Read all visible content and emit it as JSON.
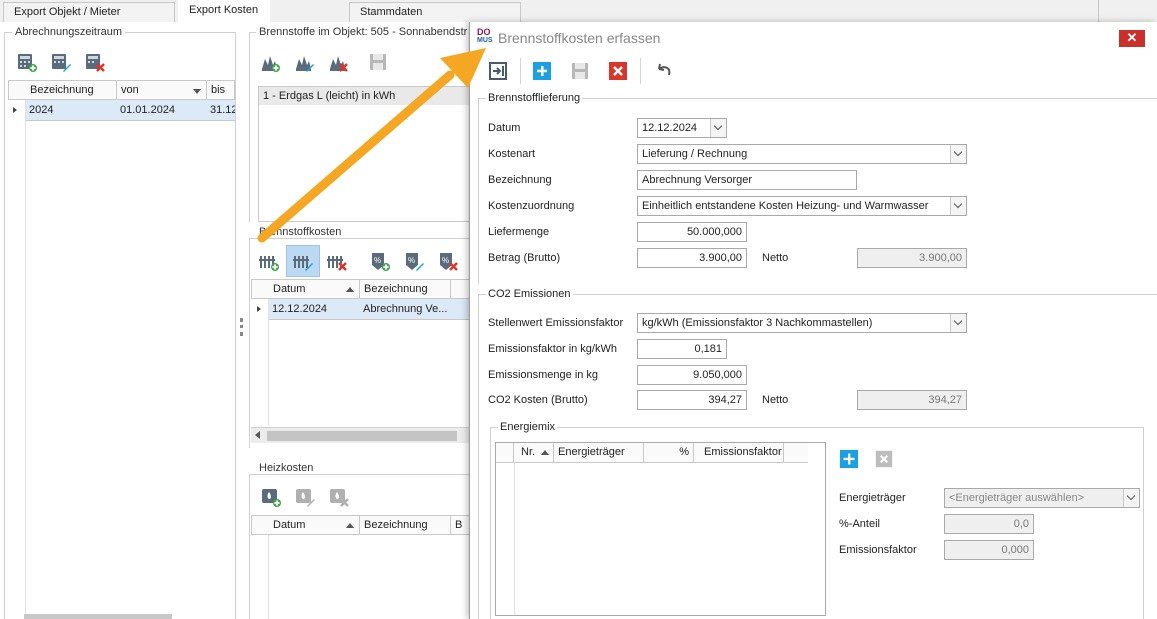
{
  "tabs": [
    "Export Objekt / Mieter",
    "Export Kosten",
    "Stammdaten"
  ],
  "left": {
    "title": "Abrechnungszeitraum",
    "columns": [
      "Bezeichnung",
      "von",
      "bis"
    ],
    "row": {
      "bezeichnung": "2024",
      "von": "01.01.2024",
      "bis": "31.12"
    }
  },
  "brennstoffe": {
    "title": "Brennstoffe im Objekt: 505 - Sonnabendstr",
    "item": "1 - Erdgas L (leicht) in kWh"
  },
  "brennstoffkosten": {
    "title": "Brennstoffkosten",
    "columns": [
      "Datum",
      "Bezeichnung"
    ],
    "row": {
      "datum": "12.12.2024",
      "bezeichnung": "Abrechnung Ve..."
    }
  },
  "heizkosten": {
    "title": "Heizkosten",
    "columns": [
      "Datum",
      "Bezeichnung",
      "B"
    ]
  },
  "dialog": {
    "logo_top": "DO",
    "logo_bottom": "MUS",
    "title": "Brennstoffkosten erfassen",
    "close": "✕",
    "section1": "Brennstofflieferung",
    "datum_label": "Datum",
    "datum_value": "12.12.2024",
    "kostenart_label": "Kostenart",
    "kostenart_value": "Lieferung / Rechnung",
    "bezeichnung_label": "Bezeichnung",
    "bezeichnung_value": "Abrechnung Versorger",
    "kostenzuordnung_label": "Kostenzuordnung",
    "kostenzuordnung_value": "Einheitlich entstandene Kosten Heizung- und Warmwasser",
    "liefermenge_label": "Liefermenge",
    "liefermenge_value": "50.000,000",
    "betrag_label": "Betrag (Brutto)",
    "betrag_value": "3.900,00",
    "netto_label": "Netto",
    "netto_value": "3.900,00",
    "section2": "CO2 Emissionen",
    "stellenwert_label": "Stellenwert Emissionsfaktor",
    "stellenwert_value": "kg/kWh (Emissionsfaktor 3 Nachkommastellen)",
    "emissionsfaktor_label": "Emissionsfaktor in kg/kWh",
    "emissionsfaktor_value": "0,181",
    "emissionsmenge_label": "Emissionsmenge in kg",
    "emissionsmenge_value": "9.050,000",
    "co2kosten_label": "CO2 Kosten (Brutto)",
    "co2kosten_value": "394,27",
    "co2netto_label": "Netto",
    "co2netto_value": "394,27",
    "energiemix": {
      "title": "Energiemix",
      "columns": [
        "Nr.",
        "Energieträger",
        "%",
        "Emissionsfaktor"
      ],
      "energietraeger_label": "Energieträger",
      "energietraeger_placeholder": "<Energieträger auswählen>",
      "anteil_label": "%-Anteil",
      "anteil_value": "0,0",
      "faktor_label": "Emissionsfaktor",
      "faktor_value": "0,000"
    }
  },
  "colors": {
    "accent_blue": "#1ba1e2",
    "delete_red": "#d9362b",
    "arrow": "#f5a623"
  }
}
